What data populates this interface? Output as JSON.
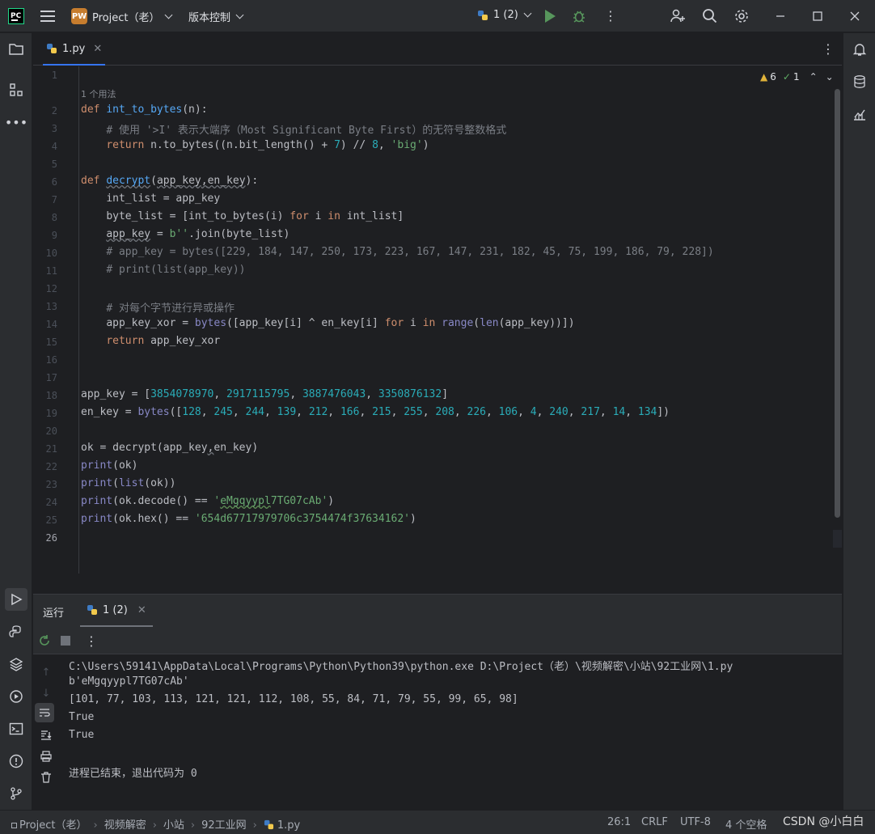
{
  "titlebar": {
    "logo_text": "PC",
    "project_badge": "PW",
    "project_name": "Project（老）",
    "vcs_label": "版本控制",
    "run_config": "1 (2)"
  },
  "editor": {
    "tab_label": "1.py",
    "usage_hint": "1 个用法",
    "warnings": "6",
    "checks": "1",
    "line_numbers": [
      "1",
      "2",
      "3",
      "4",
      "5",
      "6",
      "7",
      "8",
      "9",
      "10",
      "11",
      "12",
      "13",
      "14",
      "15",
      "16",
      "17",
      "18",
      "19",
      "20",
      "21",
      "22",
      "23",
      "24",
      "25",
      "26"
    ]
  },
  "code": {
    "l2": [
      "def",
      "int_to_bytes",
      "(n):"
    ],
    "l3": "# 使用 '>I' 表示大端序（Most Significant Byte First）的无符号整数格式",
    "l4": [
      "return",
      " n.to_bytes((n.bit_length() + ",
      "7",
      ") // ",
      "8",
      ", ",
      "'big'",
      ")"
    ],
    "l6": [
      "def",
      "decrypt",
      "(",
      "app_key",
      ",",
      "en_key",
      "):"
    ],
    "l7": "int_list = app_key",
    "l8": [
      "byte_list = [int_to_bytes(i) ",
      "for",
      " i ",
      "in",
      " int_list]"
    ],
    "l9": [
      "app_key",
      " = ",
      "b''",
      ".join(byte_list)"
    ],
    "l10": "# app_key = bytes([229, 184, 147, 250, 173, 223, 167, 147, 231, 182, 45, 75, 199, 186, 79, 228])",
    "l11": "# print(list(app_key))",
    "l13": "# 对每个字节进行异或操作",
    "l14": [
      "app_key_xor = ",
      "bytes",
      "([app_key[i] ^ en_key[i] ",
      "for",
      " i ",
      "in",
      " ",
      "range",
      "(",
      "len",
      "(app_key))])"
    ],
    "l15": [
      "return",
      " app_key_xor"
    ],
    "l18": [
      "app_key = [",
      "3854078970",
      ", ",
      "2917115795",
      ", ",
      "3887476043",
      ", ",
      "3350876132",
      "]"
    ],
    "l19_prefix": "en_key = ",
    "l19_fn": "bytes",
    "l19_open": "([",
    "l19_values": [
      "128",
      "245",
      "244",
      "139",
      "212",
      "166",
      "215",
      "255",
      "208",
      "226",
      "106",
      "4",
      "240",
      "217",
      "14",
      "134"
    ],
    "l19_close": "])",
    "l21": [
      "ok = decrypt(app_key",
      ",",
      "en_key)"
    ],
    "l22": [
      "print",
      "(ok)"
    ],
    "l23": [
      "print",
      "(",
      "list",
      "(ok))"
    ],
    "l24": [
      "print",
      "(ok.decode() == ",
      "'",
      "eMgqyypl",
      "7TG07cAb'",
      ")"
    ],
    "l25": [
      "print",
      "(ok.hex() == ",
      "'654d67717979706c3754474f37634162'",
      ")"
    ]
  },
  "run": {
    "title": "运行",
    "tab_label": "1 (2)",
    "output": [
      "C:\\Users\\59141\\AppData\\Local\\Programs\\Python\\Python39\\python.exe D:\\Project（老）\\视频解密\\小站\\92工业网\\1.py",
      "b'eMgqyypl7TG07cAb'",
      "[101, 77, 103, 113, 121, 121, 112, 108, 55, 84, 71, 79, 55, 99, 65, 98]",
      "True",
      "True",
      "",
      "进程已结束，退出代码为 0"
    ]
  },
  "statusbar": {
    "breadcrumb": [
      "Project（老）",
      "视频解密",
      "小站",
      "92工业网",
      "1.py"
    ],
    "position": "26:1",
    "line_sep": "CRLF",
    "encoding": "UTF-8",
    "indent": "4 个空格",
    "watermark": "CSDN @小白白"
  },
  "colors": {
    "accent": "#3574f0",
    "run_green": "#57965c",
    "keyword": "#cf8e6d",
    "function": "#56a8f5",
    "number": "#2aacb8",
    "string": "#6aab73",
    "comment": "#7a7e85"
  }
}
